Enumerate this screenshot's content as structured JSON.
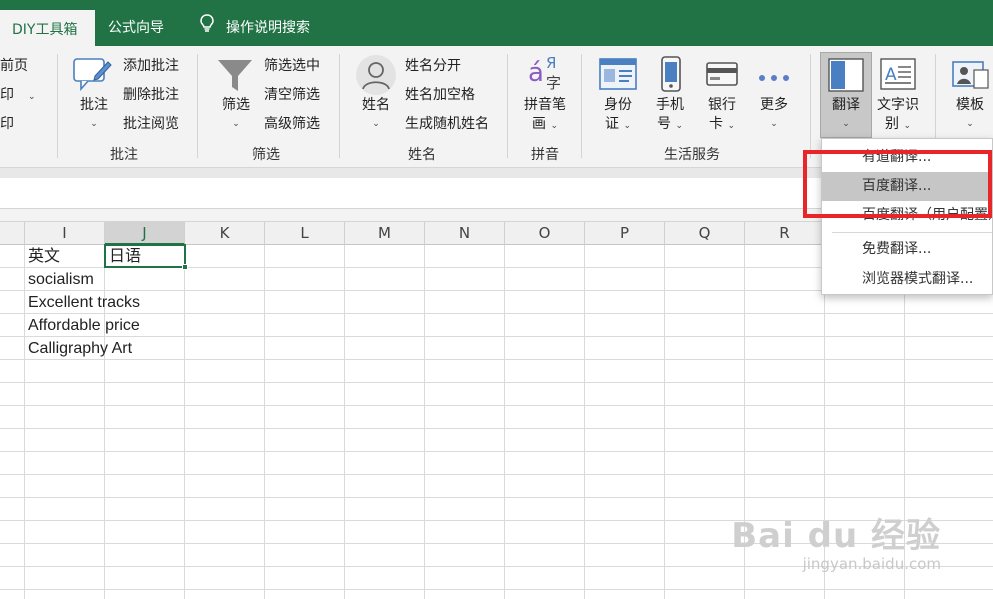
{
  "tabs": {
    "diy_toolbox": "DIY工具箱",
    "formula_wizard": "公式向导",
    "help_search": "操作说明搜索"
  },
  "ribbon": {
    "print": {
      "front_page": "前页",
      "print1": "印",
      "print2": "印"
    },
    "comment": {
      "big_label": "批注",
      "add": "添加批注",
      "delete": "删除批注",
      "review": "批注阅览",
      "group": "批注"
    },
    "filter": {
      "big_label": "筛选",
      "filter_selected": "筛选选中",
      "clear": "清空筛选",
      "advanced": "高级筛选",
      "group": "筛选"
    },
    "name": {
      "big_label": "姓名",
      "split": "姓名分开",
      "add_space": "姓名加空格",
      "random": "生成随机姓名",
      "group": "姓名"
    },
    "pinyin": {
      "big_label_1": "拼音笔",
      "big_label_2": "画",
      "group": "拼音",
      "icon_text": "á",
      "icon_char": "字",
      "icon_ya": "Я"
    },
    "life": {
      "id_card_1": "身份",
      "id_card_2": "证",
      "phone_1": "手机",
      "phone_2": "号",
      "bank_1": "银行",
      "bank_2": "卡",
      "more": "更多",
      "group": "生活服务"
    },
    "translate": {
      "big_label": "翻译",
      "ocr_1": "文字识",
      "ocr_2": "别",
      "template": "模板"
    }
  },
  "grid": {
    "columns": [
      "I",
      "J",
      "K",
      "L",
      "M",
      "N",
      "O",
      "P",
      "Q",
      "R"
    ],
    "selected_column": "J",
    "header_row": {
      "english": "英文",
      "japanese": "日语"
    },
    "english_values": [
      "socialism",
      "Excellent tracks",
      "Affordable price",
      "Calligraphy Art"
    ]
  },
  "translate_menu": {
    "items": [
      "有道翻译...",
      "百度翻译...",
      "百度翻译（用户配置）",
      "免费翻译...",
      "浏览器模式翻译..."
    ],
    "highlighted_index": 1
  },
  "watermark": {
    "main": "Bai du 经验",
    "sub": "jingyan.baidu.com"
  },
  "colors": {
    "brand_green": "#217346",
    "highlight_red": "#e8262a"
  }
}
